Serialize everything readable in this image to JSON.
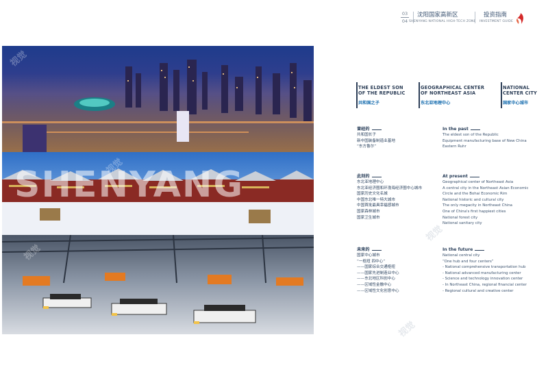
{
  "header": {
    "page_top": "03",
    "page_bottom": "04",
    "zone_cn": "沈阳国家高新区",
    "zone_en": "SHENYANG NATIONAL HIGH-TECH ZONE",
    "guide_cn": "投资指南",
    "guide_en": "INVESTMENT GUIDE"
  },
  "watermark": "视觉",
  "photo_overlay_text": "SHENYANG",
  "columns": [
    {
      "title_line1": "THE ELDEST SON",
      "title_line2": "OF THE REPUBLIC",
      "subtitle": "共和国之子"
    },
    {
      "title_line1": "GEOGRAPHICAL CENTER",
      "title_line2": "OF NORTHEAST ASIA",
      "subtitle": "东北亚地理中心"
    },
    {
      "title_line1": "NATIONAL",
      "title_line2": "CENTER CITY",
      "subtitle": "国家中心城市"
    }
  ],
  "past_cn": {
    "title": "曾经的",
    "lines": [
      "共和国长子",
      "新中国装备制造业基地",
      "“东方鲁尔”"
    ]
  },
  "past_en": {
    "title": "In the past",
    "lines": [
      "The eldest son of the Republic",
      "Equipment manufacturing base of New China",
      "Eastern Ruhr"
    ]
  },
  "present_cn": {
    "title": "此刻的",
    "lines": [
      "东北亚地理中心",
      "东北亚经济圈和环渤海经济圈中心城市",
      "国家历史文化名城",
      "中国东北唯一特大城市",
      "中国首批最具幸福感城市",
      "国家森林城市",
      "国家卫生城市"
    ]
  },
  "present_en": {
    "title": "At present",
    "lines": [
      "Geographical center of Northeast Asia",
      "A central city in the Northeast Asian Economic",
      "Circle and the Bohai Economic Rim",
      "National historic and cultural city",
      "The only megacity in Northeast China",
      "One of China's first happiest cities",
      "National forest city",
      "National sanitary city"
    ]
  },
  "future_cn": {
    "title": "未来的",
    "lines": [
      "国家中心城市",
      "“一枢纽 四中心”",
      "——国家综合交通枢纽",
      "——国家先进制造业中心",
      "——东北地区科创中心",
      "——区域性金融中心",
      "——区域性文化创意中心"
    ]
  },
  "future_en": {
    "title": "In the future",
    "lines": [
      "National central city",
      "“One hub and four centers”",
      "- National comprehensive transportation hub",
      "- National advanced manufacturing center",
      "- Science and technology innovation center",
      "- In Northeast China, regional financial center",
      "- Regional cultural and creative center"
    ]
  },
  "colors": {
    "accent_blue": "#1a6fb0",
    "brand_red": "#d42a2a",
    "text_dark": "#2a3f5a"
  }
}
